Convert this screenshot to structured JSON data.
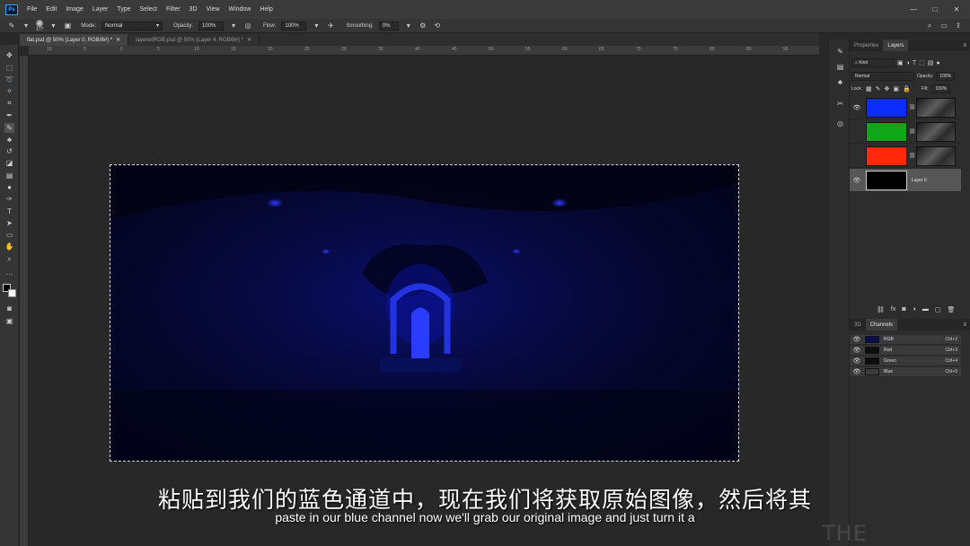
{
  "app": {
    "logo": "Ps"
  },
  "menu": [
    "File",
    "Edit",
    "Image",
    "Layer",
    "Type",
    "Select",
    "Filter",
    "3D",
    "View",
    "Window",
    "Help"
  ],
  "window_controls": [
    "—",
    "□",
    "✕"
  ],
  "options_bar": {
    "brush_size": "177",
    "mode_label": "Mode:",
    "mode_value": "Normal",
    "opacity_label": "Opacity:",
    "opacity_value": "100%",
    "flow_label": "Flow:",
    "flow_value": "100%",
    "smoothing_label": "Smoothing:",
    "smoothing_value": "0%"
  },
  "tabs": [
    {
      "label": "flat.psd @ 50% (Layer 0, RGB/8#) *",
      "active": true
    },
    {
      "label": "layeredRGB.psd @ 50% (Layer 4, RGB/8#) *",
      "active": false
    }
  ],
  "ruler_top": [
    "10",
    "5",
    "0",
    "5",
    "10",
    "15",
    "20",
    "25",
    "30",
    "35",
    "40",
    "45",
    "50",
    "55",
    "60",
    "65",
    "70",
    "75",
    "80",
    "85",
    "90",
    "95"
  ],
  "layers_panel": {
    "tabs": [
      "Properties",
      "Layers"
    ],
    "filter_value": "Kind",
    "blend_value": "Normal",
    "opacity_label": "Opacity:",
    "opacity_value": "100%",
    "lock_label": "Lock:",
    "fill_label": "Fill:",
    "fill_value": "100%",
    "layers": [
      {
        "name": "",
        "color": "#0c2cff",
        "visible": true,
        "has_mask": true
      },
      {
        "name": "",
        "color": "#12a61a",
        "visible": false,
        "has_mask": true
      },
      {
        "name": "",
        "color": "#ff2a0c",
        "visible": false,
        "has_mask": true
      },
      {
        "name": "Layer 0",
        "color": "#000000",
        "visible": true,
        "has_mask": false,
        "selected": true
      }
    ]
  },
  "channels_panel": {
    "tabs": [
      "3D",
      "Channels"
    ],
    "channels": [
      {
        "name": "RGB",
        "shortcut": "Ctrl+2",
        "thumb": "#0a0d50"
      },
      {
        "name": "Red",
        "shortcut": "Ctrl+3",
        "thumb": "#0e0e0e"
      },
      {
        "name": "Green",
        "shortcut": "Ctrl+4",
        "thumb": "#0e0e0e"
      },
      {
        "name": "Blue",
        "shortcut": "Ctrl+5",
        "thumb": "#3c3c3c"
      }
    ]
  },
  "subtitles": {
    "chinese": "粘贴到我们的蓝色通道中，现在我们将获取原始图像，然后将其",
    "english": "paste in our blue channel now we'll grab our original image and just turn it a"
  },
  "watermark": "THE GNOMON",
  "colors": {
    "accent": "#31a8ff",
    "canvas_blue": "#0b0f6a"
  }
}
